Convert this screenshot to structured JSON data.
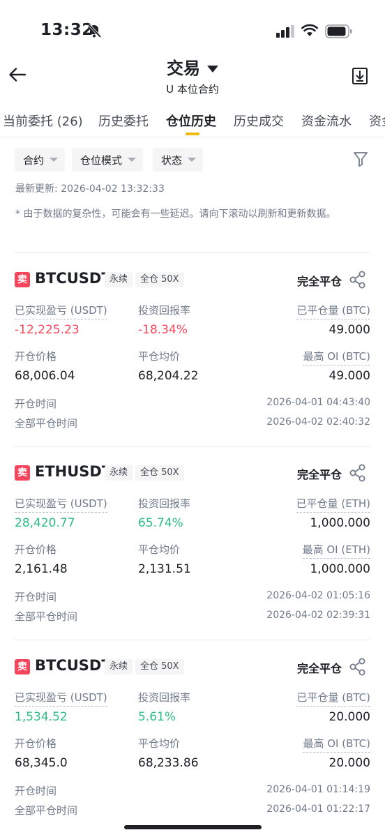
{
  "status_bar": {
    "time": "13:32"
  },
  "header": {
    "title": "交易",
    "subtitle": "U 本位合约"
  },
  "tabs": [
    {
      "label": "当前委托 (26)"
    },
    {
      "label": "历史委托"
    },
    {
      "label": "仓位历史"
    },
    {
      "label": "历史成交"
    },
    {
      "label": "资金流水"
    },
    {
      "label": "资金"
    }
  ],
  "filters": {
    "contract": "合约",
    "position_mode": "仓位模式",
    "status": "状态"
  },
  "last_updated": "最新更新: 2026-04-02 13:32:33",
  "notice": "* 由于数据的复杂性，可能会有一些延迟。请向下滚动以刷新和更新数据。",
  "labels": {
    "realized_pnl": "已实现盈亏 (USDT)",
    "roi": "投资回报率",
    "entry_price": "开仓价格",
    "avg_close_price": "平仓均价",
    "open_time": "开仓时间",
    "full_close_time": "全部平仓时间"
  },
  "colors": {
    "accent": "#f0b90b",
    "sell": "#f6465d",
    "profit": "#2ebd85",
    "loss": "#f6465d"
  },
  "positions": [
    {
      "side": "卖",
      "symbol": "BTCUSDT",
      "type": "永续",
      "margin": "全仓 50X",
      "status": "完全平仓",
      "realized_pnl": "-12,225.23",
      "roi": "-18.34%",
      "closed_qty_label": "已平仓量 (BTC)",
      "closed_qty": "49.000",
      "entry_price": "68,006.04",
      "avg_close_price": "68,204.22",
      "max_oi_label": "最高 OI (BTC)",
      "max_oi": "49.000",
      "open_time": "2026-04-01 04:43:40",
      "close_time": "2026-04-02 02:40:32"
    },
    {
      "side": "卖",
      "symbol": "ETHUSDT",
      "type": "永续",
      "margin": "全仓 50X",
      "status": "完全平仓",
      "realized_pnl": "28,420.77",
      "roi": "65.74%",
      "closed_qty_label": "已平仓量 (ETH)",
      "closed_qty": "1,000.000",
      "entry_price": "2,161.48",
      "avg_close_price": "2,131.51",
      "max_oi_label": "最高 OI (ETH)",
      "max_oi": "1,000.000",
      "open_time": "2026-04-02 01:05:16",
      "close_time": "2026-04-02 02:39:31"
    },
    {
      "side": "卖",
      "symbol": "BTCUSDT",
      "type": "永续",
      "margin": "全仓 50X",
      "status": "完全平仓",
      "realized_pnl": "1,534.52",
      "roi": "5.61%",
      "closed_qty_label": "已平仓量 (BTC)",
      "closed_qty": "20.000",
      "entry_price": "68,345.0",
      "avg_close_price": "68,233.86",
      "max_oi_label": "最高 OI (BTC)",
      "max_oi": "20.000",
      "open_time": "2026-04-01 01:14:19",
      "close_time": "2026-04-01 01:22:17"
    }
  ]
}
